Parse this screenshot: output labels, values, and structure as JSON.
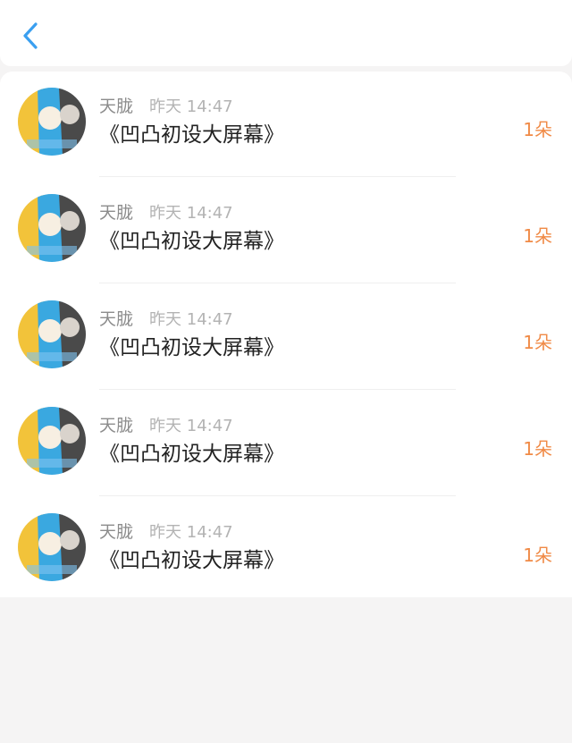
{
  "colors": {
    "accent_blue": "#3a9ff0",
    "amount_orange": "#f08a46",
    "name_gray": "#8c8c8c",
    "time_gray": "#b3b3b3"
  },
  "header": {
    "back_icon": "chevron-left-icon"
  },
  "list": {
    "items": [
      {
        "name": "天胧",
        "time": "昨天 14:47",
        "title": "《凹凸初设大屏幕》",
        "amount": "1朵"
      },
      {
        "name": "天胧",
        "time": "昨天 14:47",
        "title": "《凹凸初设大屏幕》",
        "amount": "1朵"
      },
      {
        "name": "天胧",
        "time": "昨天 14:47",
        "title": "《凹凸初设大屏幕》",
        "amount": "1朵"
      },
      {
        "name": "天胧",
        "time": "昨天 14:47",
        "title": "《凹凸初设大屏幕》",
        "amount": "1朵"
      },
      {
        "name": "天胧",
        "time": "昨天 14:47",
        "title": "《凹凸初设大屏幕》",
        "amount": "1朵"
      }
    ]
  }
}
